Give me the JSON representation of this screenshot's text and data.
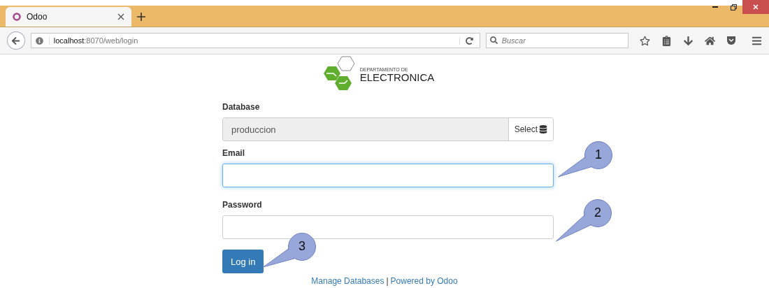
{
  "browser": {
    "tab": {
      "title": "Odoo",
      "selected": true
    },
    "url": "**localhost**:8070/web/login",
    "search": {
      "placeholder": "Buscar"
    }
  },
  "logo": {
    "line_1": "DEPARTAMENTO DE",
    "line_2": "ELECTRONICA"
  },
  "form": {
    "database": {
      "label": "Database",
      "value": "produccion",
      "readonly": true,
      "button": "Select"
    },
    "email": {
      "label": "Email",
      "focused": true
    },
    "password": {
      "label": "Password",
      "focused": false
    },
    "submit": "Log in"
  },
  "footer": {
    "links": [
      "Manage Databases",
      "Powered by Odoo"
    ],
    "separator": "|"
  },
  "callouts": [
    {
      "number": "1"
    },
    {
      "number": "2"
    },
    {
      "number": "3"
    }
  ]
}
